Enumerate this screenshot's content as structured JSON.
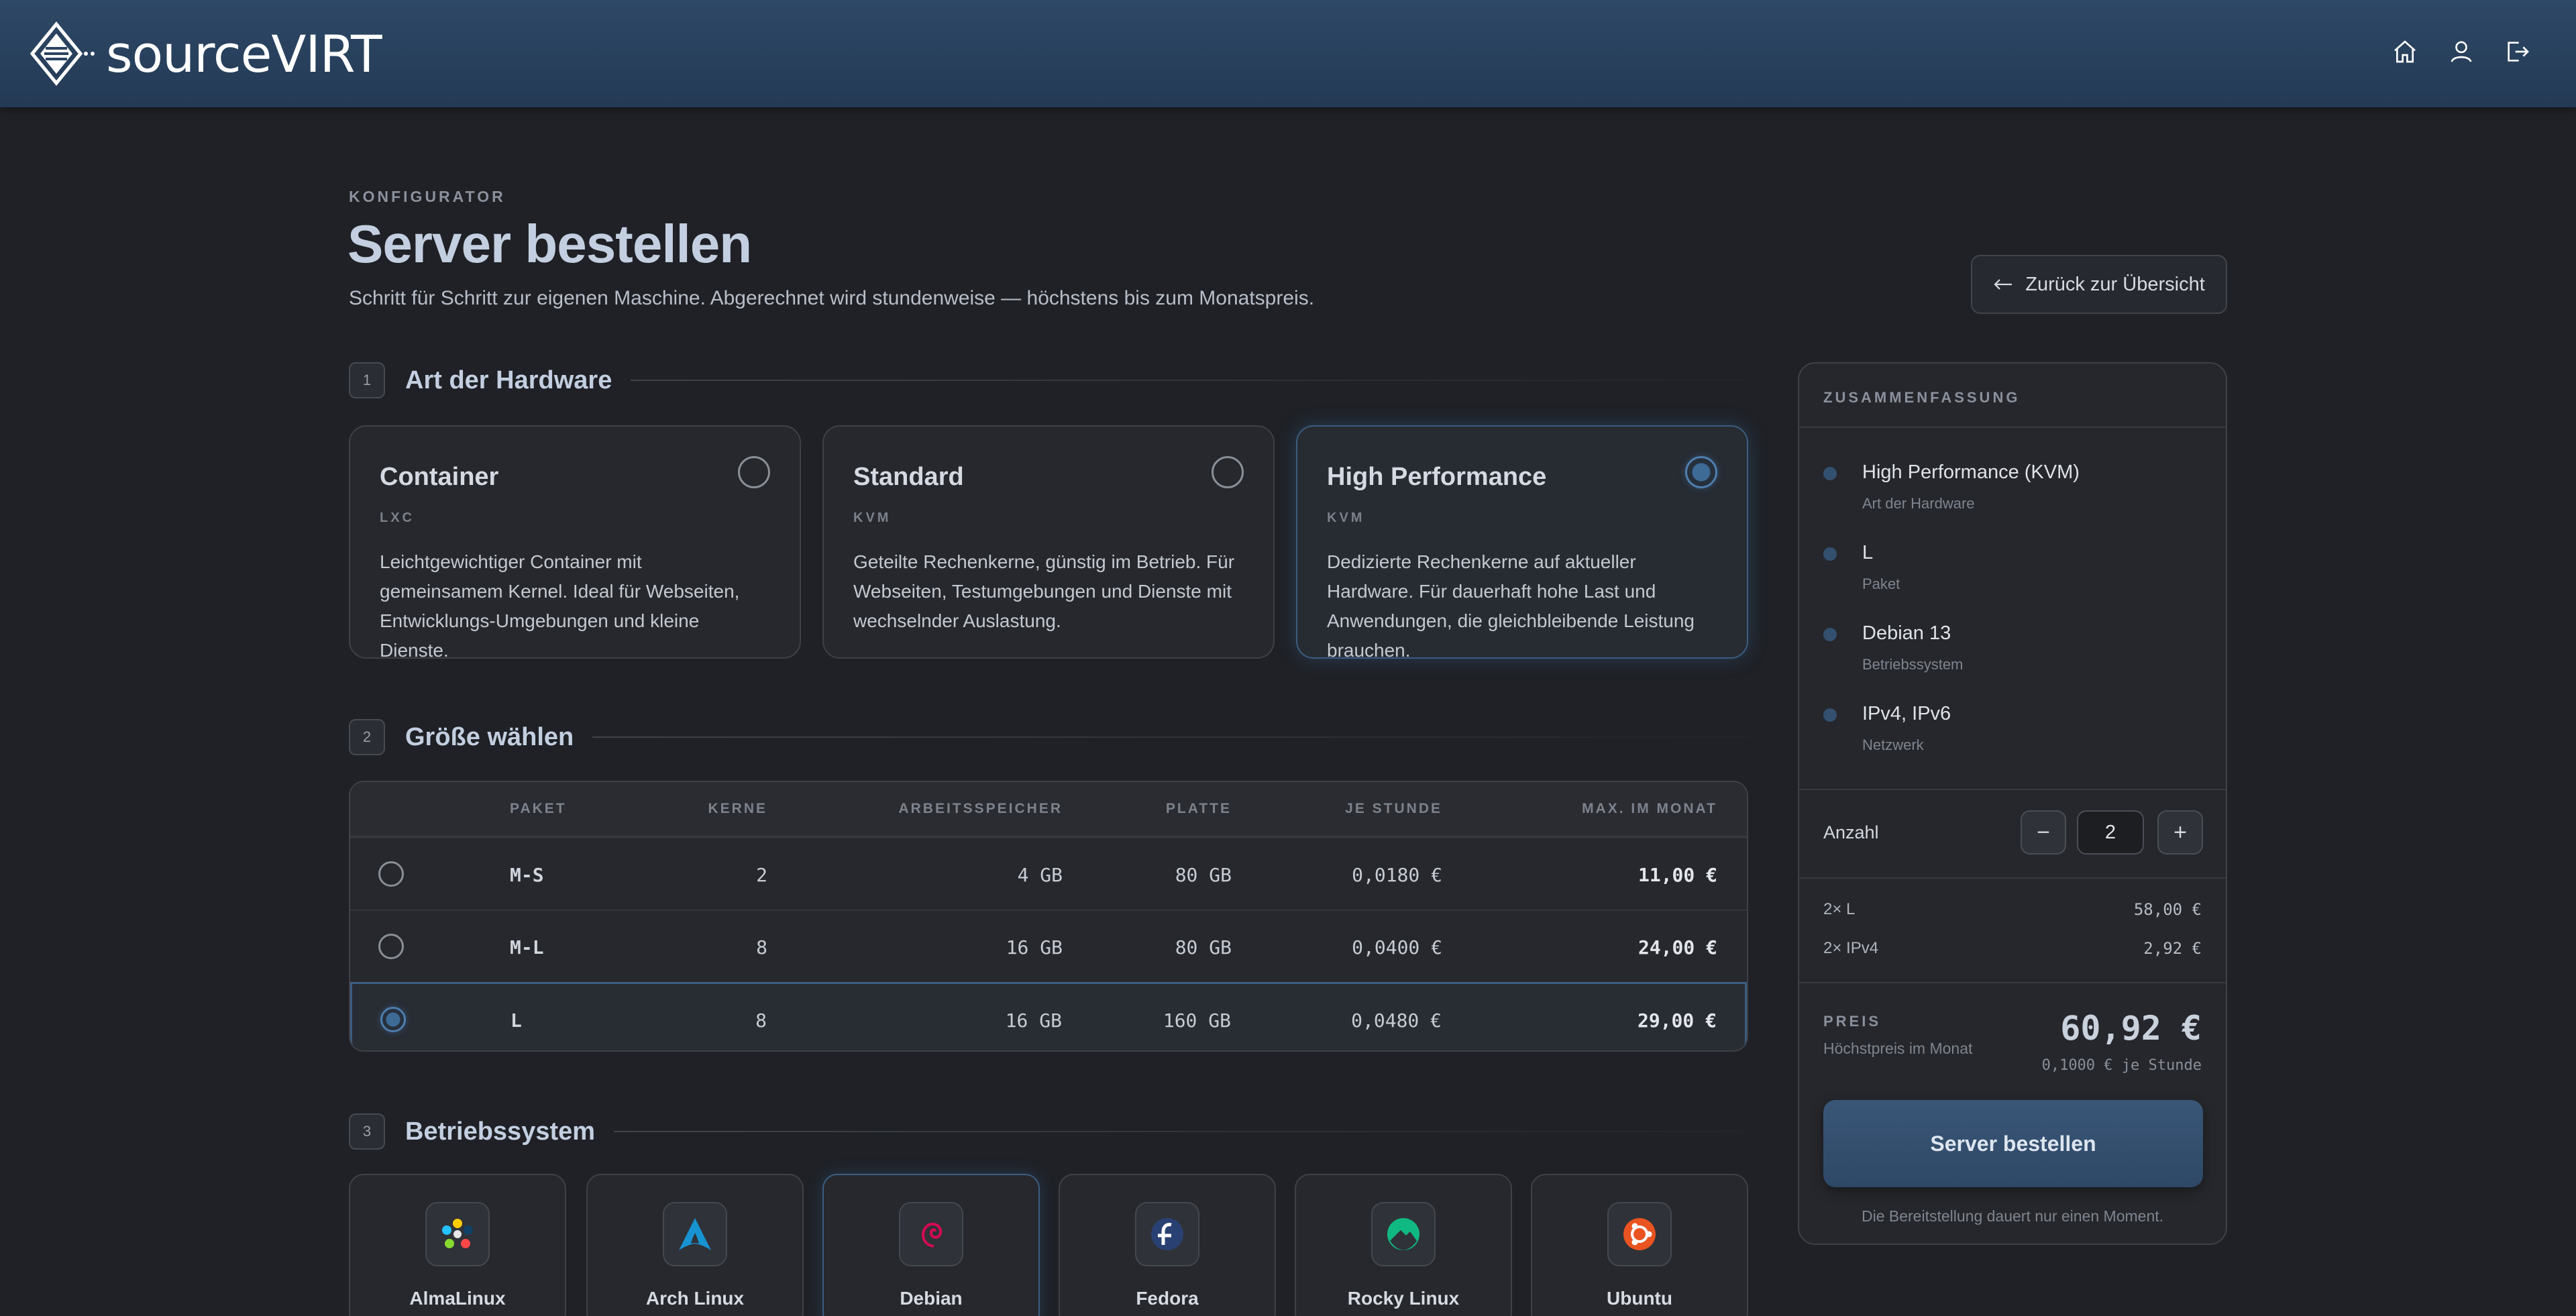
{
  "header": {
    "brand_text": "sourceVIRT",
    "icons": [
      "home-icon",
      "user-icon",
      "logout-icon"
    ]
  },
  "page": {
    "eyebrow": "KONFIGURATOR",
    "title": "Server bestellen",
    "subtitle": "Schritt für Schritt zur eigenen Maschine. Abgerechnet wird stundenweise — höchstens bis zum Monatspreis.",
    "back_label": "Zurück zur Übersicht"
  },
  "sections": {
    "hardware": {
      "num": "1",
      "title": "Art der Hardware"
    },
    "size": {
      "num": "2",
      "title": "Größe wählen"
    },
    "os": {
      "num": "3",
      "title": "Betriebssystem"
    }
  },
  "hardware": [
    {
      "title": "Container",
      "tag": "LXC",
      "desc": "Leichtgewichtiger Container mit gemeinsamem Kernel. Ideal für Webseiten, Entwicklungs-Umgebungen und kleine Dienste.",
      "selected": false
    },
    {
      "title": "Standard",
      "tag": "KVM",
      "desc": "Geteilte Rechenkerne, günstig im Betrieb. Für Webseiten, Testumgebungen und Dienste mit wechselnder Auslastung.",
      "selected": false
    },
    {
      "title": "High Performance",
      "tag": "KVM",
      "desc": "Dedizierte Rechenkerne auf aktueller Hardware. Für dauerhaft hohe Last und Anwendungen, die gleichbleibende Leistung brauchen.",
      "selected": true
    }
  ],
  "table": {
    "headers": [
      "PAKET",
      "KERNE",
      "ARBEITSSPEICHER",
      "PLATTE",
      "JE STUNDE",
      "MAX. IM MONAT"
    ],
    "rows": [
      {
        "paket": "M-S",
        "kerne": "2",
        "ram": "4 GB",
        "platte": "80 GB",
        "stunde": "0,0180 €",
        "monat": "11,00 €",
        "selected": false
      },
      {
        "paket": "M-L",
        "kerne": "8",
        "ram": "16 GB",
        "platte": "80 GB",
        "stunde": "0,0400 €",
        "monat": "24,00 €",
        "selected": false
      },
      {
        "paket": "L",
        "kerne": "8",
        "ram": "16 GB",
        "platte": "160 GB",
        "stunde": "0,0480 €",
        "monat": "29,00 €",
        "selected": true
      }
    ]
  },
  "os": [
    {
      "name": "AlmaLinux",
      "icon": "almalinux-icon",
      "selected": false
    },
    {
      "name": "Arch Linux",
      "icon": "archlinux-icon",
      "selected": false
    },
    {
      "name": "Debian",
      "icon": "debian-icon",
      "selected": true
    },
    {
      "name": "Fedora",
      "icon": "fedora-icon",
      "selected": false
    },
    {
      "name": "Rocky Linux",
      "icon": "rockylinux-icon",
      "selected": false
    },
    {
      "name": "Ubuntu",
      "icon": "ubuntu-icon",
      "selected": false
    }
  ],
  "summary": {
    "title": "ZUSAMMENFASSUNG",
    "items": [
      {
        "value": "High Performance (KVM)",
        "label": "Art der Hardware"
      },
      {
        "value": "L",
        "label": "Paket"
      },
      {
        "value": "Debian 13",
        "label": "Betriebssystem"
      },
      {
        "value": "IPv4, IPv6",
        "label": "Netzwerk"
      }
    ],
    "qty_label": "Anzahl",
    "qty_value": "2",
    "minus": "−",
    "plus": "+",
    "lines": [
      {
        "label": "2× L",
        "value": "58,00 €"
      },
      {
        "label": "2× IPv4",
        "value": "2,92 €"
      }
    ],
    "price_label": "PREIS",
    "price_sub": "Höchstpreis im Monat",
    "price_value": "60,92 €",
    "price_hour": "0,1000 € je Stunde",
    "order_label": "Server bestellen",
    "order_note": "Die Bereitstellung dauert nur einen Moment."
  },
  "colors": {
    "accent": "#3c5d80",
    "background": "#1f2126",
    "header": "#2d4866"
  }
}
